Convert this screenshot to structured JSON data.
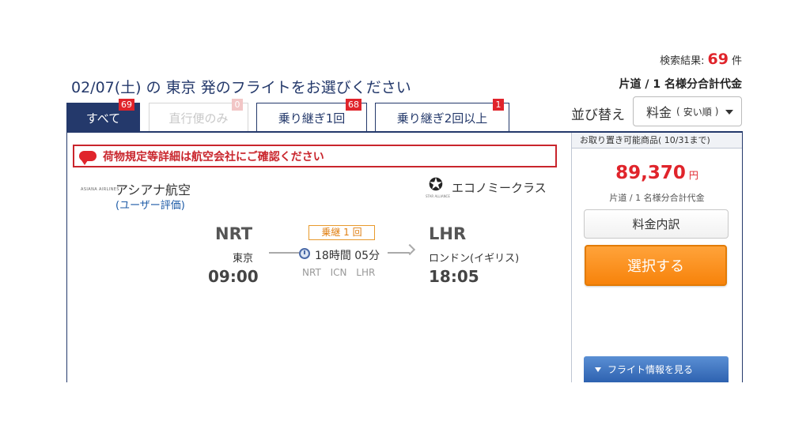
{
  "results": {
    "label": "検索結果:",
    "count": "69",
    "unit": "件"
  },
  "title": "02/07(土) の 東京 発のフライトをお選びください",
  "price_basis": "片道 / 1 名様分合計代金",
  "tabs": [
    {
      "label": "すべて",
      "count": "69"
    },
    {
      "label": "直行便のみ",
      "count": "0"
    },
    {
      "label": "乗り継ぎ1回",
      "count": "68"
    },
    {
      "label": "乗り継ぎ2回以上",
      "count": "1"
    }
  ],
  "sort": {
    "label": "並び替え",
    "value": "料金",
    "paren_open": "(",
    "qualifier": "安い順",
    "paren_close": ")"
  },
  "notice": "荷物規定等詳細は航空会社にご確認ください",
  "flight": {
    "airline_logo_text": "ASIANA AIRLINES",
    "airline": "アシアナ航空",
    "rating_link": "(ユーザー評価)",
    "alliance_caption": "STAR ALLIANCE",
    "cabin": "エコノミークラス",
    "departure": {
      "code": "NRT",
      "city": "東京",
      "time": "09:00"
    },
    "stops": "乗継 1 回",
    "duration": "18時間 05分",
    "via": "NRT ICN LHR",
    "arrival": {
      "code": "LHR",
      "city": "ロンドン(イギリス)",
      "time": "18:05"
    }
  },
  "side": {
    "hold_label": "お取り置き可能商品( 10/31まで)",
    "price": "89,370",
    "currency": "円",
    "price_note": "片道 / 1 名様分合計代金",
    "breakdown_button": "料金内訳",
    "select_button": "選択する",
    "flight_info_button": "フライト情報を見る"
  },
  "colors": {
    "navy": "#24396b",
    "red": "#e0242b",
    "orange": "#f7830b",
    "link": "#1c5aa6"
  }
}
